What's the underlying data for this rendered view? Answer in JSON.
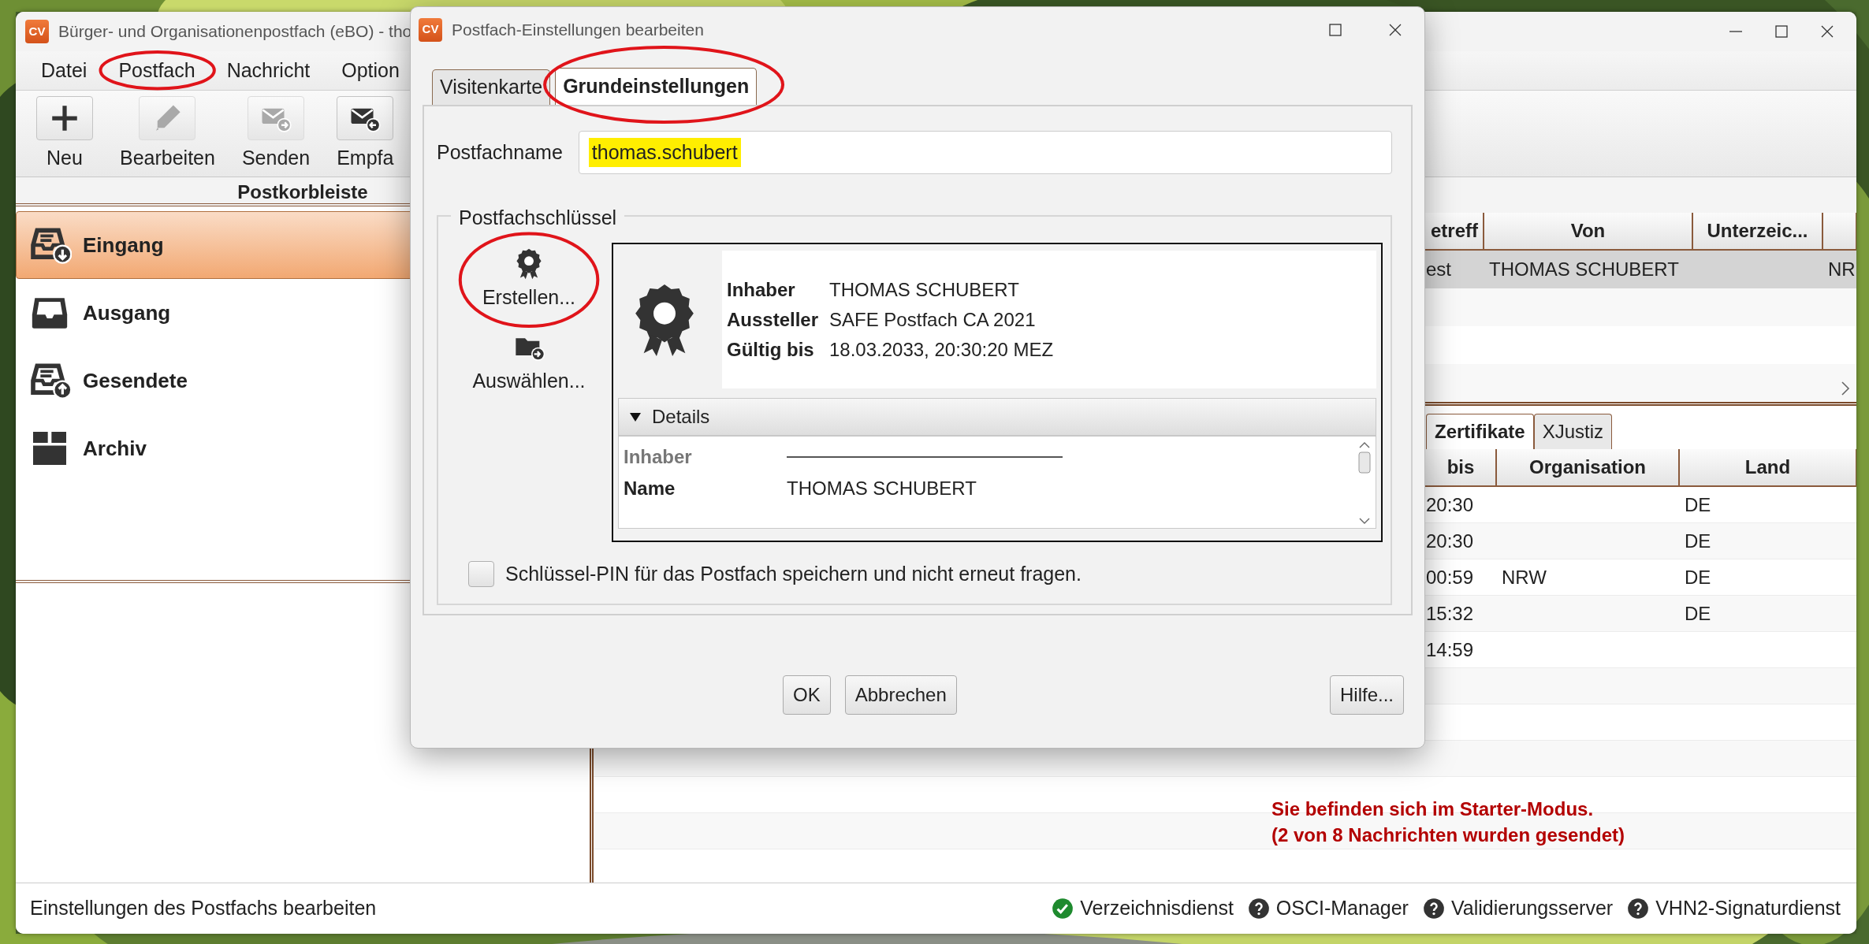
{
  "main_window": {
    "app_icon": "CV",
    "title": "Bürger- und Organisationenpostfach (eBO) - tho",
    "menu": [
      {
        "label": "Datei",
        "circled": false
      },
      {
        "label": "Postfach",
        "circled": true
      },
      {
        "label": "Nachricht",
        "circled": false
      },
      {
        "label": "Option",
        "circled": false
      }
    ],
    "toolbar": [
      {
        "label": "Neu",
        "kind": "plus",
        "disabled": false
      },
      {
        "label": "Bearbeiten",
        "kind": "edit",
        "disabled": true
      },
      {
        "label": "Senden",
        "kind": "send",
        "disabled": true
      },
      {
        "label": "Empfa",
        "kind": "receive",
        "disabled": false
      }
    ],
    "sidebar": {
      "title": "Postkorbleiste",
      "items": [
        {
          "label": "Eingang",
          "kind": "inbox",
          "selected": true
        },
        {
          "label": "Ausgang",
          "kind": "outbox",
          "selected": false
        },
        {
          "label": "Gesendete",
          "kind": "sent",
          "selected": false
        },
        {
          "label": "Archiv",
          "kind": "archive",
          "selected": false
        }
      ]
    },
    "messages": {
      "columns": [
        "etreff",
        "Von",
        "Unterzeic..."
      ],
      "rows": [
        {
          "cells": [
            "est",
            "THOMAS SCHUBERT",
            null,
            "NR"
          ],
          "selected": true
        }
      ]
    },
    "detail_tabs": [
      {
        "label": "Zertifikate",
        "selected": true
      },
      {
        "label": "XJustiz",
        "selected": false
      }
    ],
    "certificates": {
      "columns": [
        "bis",
        "Organisation",
        "Land"
      ],
      "rows": [
        [
          "20:30",
          null,
          "DE"
        ],
        [
          "20:30",
          null,
          "DE"
        ],
        [
          "00:59",
          "NRW",
          "DE"
        ],
        [
          "15:32",
          null,
          "DE"
        ],
        [
          "14:59",
          null,
          null
        ]
      ]
    },
    "notice": [
      "Sie befinden sich im Starter-Modus.",
      "(2 von 8 Nachrichten wurden gesendet)"
    ],
    "status_bar": {
      "text": "Einstellungen des Postfachs bearbeiten",
      "services": [
        {
          "label": "Verzeichnisdienst",
          "ok": true
        },
        {
          "label": "OSCI-Manager",
          "ok": false
        },
        {
          "label": "Validierungsserver",
          "ok": false
        },
        {
          "label": "VHN2-Signaturdienst",
          "ok": false
        }
      ]
    }
  },
  "dialog": {
    "app_icon": "CV",
    "title": "Postfach-Einstellungen bearbeiten",
    "tabs": [
      {
        "label": "Visitenkarte",
        "selected": false,
        "circled": false
      },
      {
        "label": "Grundeinstellungen",
        "selected": true,
        "circled": true
      }
    ],
    "postfachname": {
      "label": "Postfachname",
      "value": "thomas.schubert",
      "highlighted": true
    },
    "key_group": {
      "title": "Postfachschlüssel",
      "actions": [
        {
          "label": "Erstellen...",
          "kind": "certificate",
          "circled": true
        },
        {
          "label": "Auswählen...",
          "kind": "folder",
          "circled": false
        }
      ],
      "certificate": {
        "fields": [
          {
            "label": "Inhaber",
            "value": "THOMAS SCHUBERT"
          },
          {
            "label": "Aussteller",
            "value": "SAFE Postfach CA 2021"
          },
          {
            "label": "Gültig bis",
            "value": "18.03.2033, 20:30:20 MEZ"
          }
        ],
        "details": {
          "label": "Details",
          "expanded": true,
          "rows": [
            {
              "kind": "section",
              "label": "Inhaber"
            },
            {
              "kind": "field",
              "label": "Name",
              "value": "THOMAS SCHUBERT"
            }
          ]
        }
      },
      "save_pin": {
        "label": "Schlüssel-PIN für das Postfach speichern und nicht erneut fragen.",
        "checked": false
      }
    },
    "buttons": [
      {
        "label": "OK",
        "kind": "center"
      },
      {
        "label": "Abbrechen",
        "kind": "center"
      },
      {
        "label": "Hilfe...",
        "kind": "right"
      }
    ]
  }
}
